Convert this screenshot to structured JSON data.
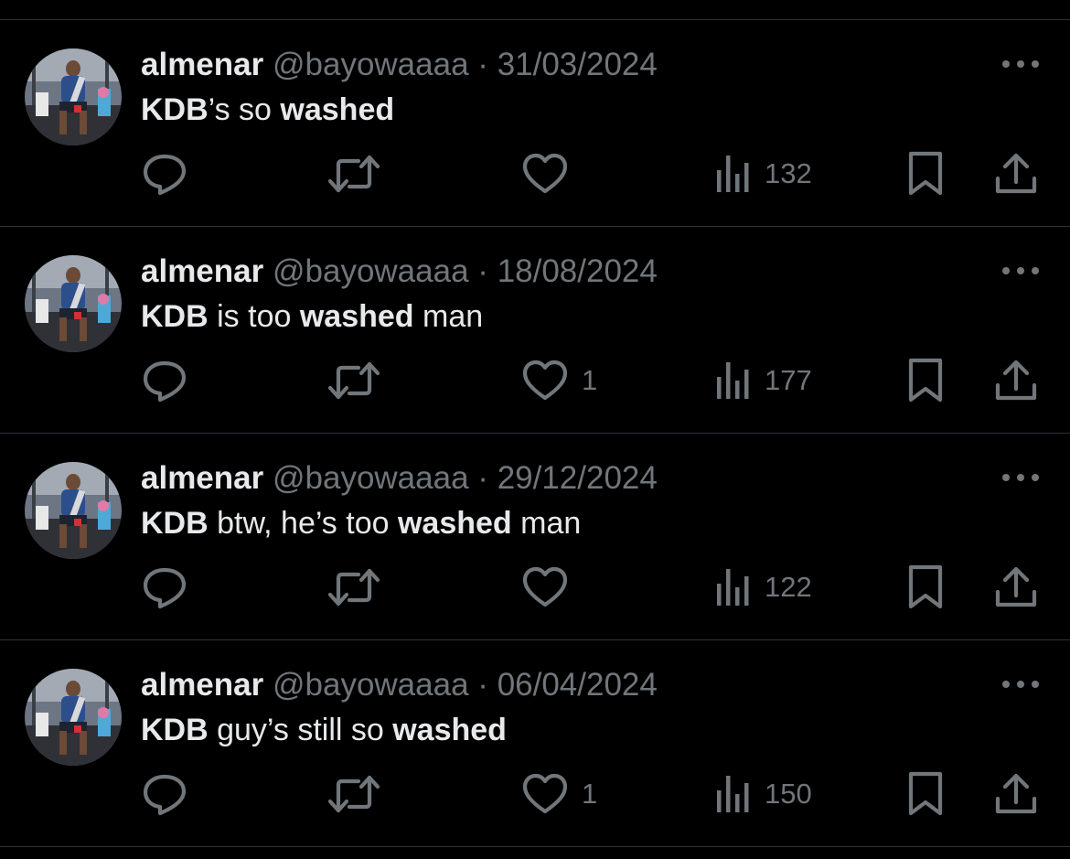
{
  "colors": {
    "background": "#000000",
    "primary_text": "#e7e9ea",
    "secondary_text": "#71767b",
    "divider": "#2f3336"
  },
  "icons": [
    "avatar",
    "more-icon",
    "reply-icon",
    "retweet-icon",
    "like-icon",
    "views-icon",
    "bookmark-icon",
    "share-icon"
  ],
  "tweets": [
    {
      "display_name": "almenar",
      "handle": "@bayowaaaa",
      "separator": "·",
      "date": "31/03/2024",
      "text_parts": [
        {
          "text": "KDB",
          "bold": true
        },
        {
          "text": "’s so ",
          "bold": false
        },
        {
          "text": "washed",
          "bold": true
        }
      ],
      "likes": "",
      "views": "132"
    },
    {
      "display_name": "almenar",
      "handle": "@bayowaaaa",
      "separator": "·",
      "date": "18/08/2024",
      "text_parts": [
        {
          "text": "KDB",
          "bold": true
        },
        {
          "text": " is too ",
          "bold": false
        },
        {
          "text": "washed",
          "bold": true
        },
        {
          "text": " man",
          "bold": false
        }
      ],
      "likes": "1",
      "views": "177"
    },
    {
      "display_name": "almenar",
      "handle": "@bayowaaaa",
      "separator": "·",
      "date": "29/12/2024",
      "text_parts": [
        {
          "text": "KDB",
          "bold": true
        },
        {
          "text": " btw, he’s too ",
          "bold": false
        },
        {
          "text": "washed",
          "bold": true
        },
        {
          "text": " man",
          "bold": false
        }
      ],
      "likes": "",
      "views": "122"
    },
    {
      "display_name": "almenar",
      "handle": "@bayowaaaa",
      "separator": "·",
      "date": "06/04/2024",
      "text_parts": [
        {
          "text": "KDB",
          "bold": true
        },
        {
          "text": " guy’s still so ",
          "bold": false
        },
        {
          "text": "washed",
          "bold": true
        }
      ],
      "likes": "1",
      "views": "150"
    }
  ]
}
